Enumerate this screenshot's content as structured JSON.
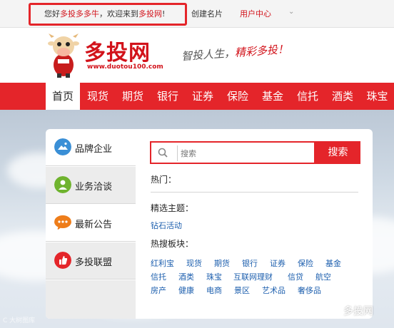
{
  "topbar": {
    "welcome_prefix": "您好",
    "username": "多投多多牛",
    "welcome_mid": "，欢迎来到",
    "site_name": "多投网",
    "welcome_suffix": "!",
    "create_card": "创建名片",
    "user_center": "用户中心",
    "dropdown_glyph": "⌄"
  },
  "header": {
    "logo_text": "多投网",
    "logo_url": "www.duotou100.com",
    "slogan_a": "智投人生，",
    "slogan_b": "精彩多投！"
  },
  "nav": {
    "items": [
      "首页",
      "现货",
      "期货",
      "银行",
      "证券",
      "保险",
      "基金",
      "信托",
      "酒类",
      "珠宝"
    ],
    "active_index": 0
  },
  "sidebar": {
    "items": [
      {
        "label": "品牌企业",
        "icon": "mountain-icon",
        "color": "#3a8fd6"
      },
      {
        "label": "业务洽谈",
        "icon": "handshake-icon",
        "color": "#6fb32e"
      },
      {
        "label": "最新公告",
        "icon": "speech-bubble-icon",
        "color": "#ee7d1a"
      },
      {
        "label": "多投联盟",
        "icon": "thumbs-up-icon",
        "color": "#e4252a"
      }
    ]
  },
  "search": {
    "placeholder": "搜索",
    "button_label": "搜索"
  },
  "hot": {
    "label": "热门："
  },
  "themes": {
    "label": "精选主题：",
    "items": [
      "钻石活动"
    ]
  },
  "hot_sections": {
    "label": "热搜板块：",
    "rows": [
      [
        "红利宝",
        "现货",
        "期货",
        "银行",
        "证券",
        "保险",
        "基金"
      ],
      [
        "信托",
        "酒类",
        "珠宝",
        "互联网理财",
        "信贷",
        "航空"
      ],
      [
        "房产",
        "健康",
        "电商",
        "景区",
        "艺术品",
        "奢侈品"
      ]
    ]
  },
  "footer": {
    "wechat_label": "多投网",
    "watermark": "C 大树图库"
  },
  "colors": {
    "brand_red": "#e4252a",
    "link_blue": "#1d5fae"
  }
}
